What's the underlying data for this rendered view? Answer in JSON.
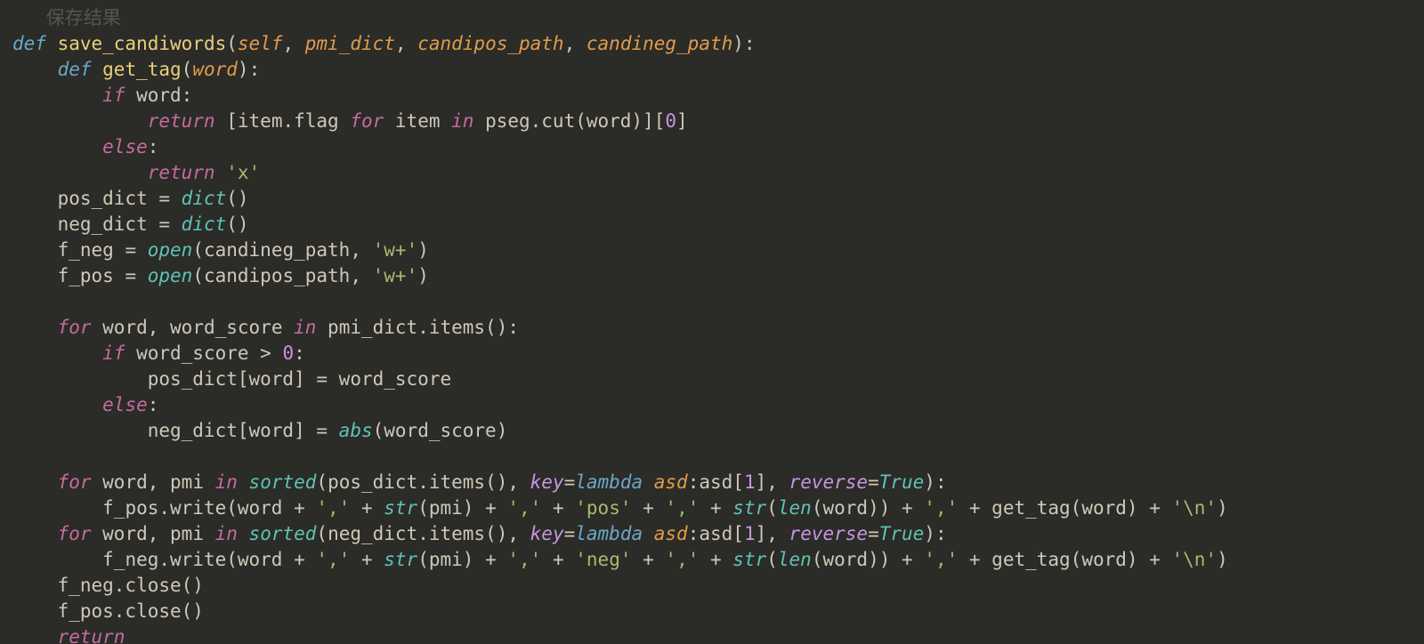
{
  "sig": {
    "def": "def ",
    "name1": "save_candiwords",
    "lp": "(",
    "self": "self",
    "c": ", ",
    "p1": "pmi_dict",
    "p2": "candipos_path",
    "p3": "candineg_path",
    "rp": ")",
    ":": ":"
  },
  "gt": {
    "def": "def ",
    "name": "get_tag",
    "lp": "(",
    "word": "word",
    "rp": ")",
    ":": ":",
    "if": "if ",
    "wref": "word",
    ":2": ":",
    "ret": "return ",
    "lb": "[",
    "item_flag": "item.flag ",
    "for": "for ",
    "item": "item ",
    "in": "in ",
    "pseg": "pseg.cut(word)",
    "rb": "][",
    "zero": "0",
    "rb2": "]",
    "else": "else",
    ":3": ":",
    "ret2": "return ",
    "xs": "'x'"
  },
  "assign": {
    "pos": "pos_dict ",
    "eq": "= ",
    "dict": "dict",
    "pp": "()",
    "neg": "neg_dict ",
    "fneg": "f_neg ",
    "open": "open",
    "lp": "(",
    "cneg": "candineg_path",
    "cm": ", ",
    "wplus": "'w+'",
    "rp": ")",
    "fpos": "f_pos ",
    "cpos": "candipos_path"
  },
  "loop1": {
    "for": "for ",
    "w": "word",
    "cm": ", ",
    "ws": "word_score ",
    "in": "in ",
    "pmi": "pmi_dict.items()",
    ":": ":",
    "if": "if ",
    "ws2": "word_score ",
    "gt": "> ",
    "zero": "0",
    ":2": ":",
    "pd": "pos_dict[word] ",
    "eq": "= ",
    "ws3": "word_score",
    "else": "else",
    ":3": ":",
    "nd": "neg_dict[word] ",
    "abs": "abs",
    "lp": "(",
    "ws4": "word_score",
    "rp": ")"
  },
  "loop2": {
    "for": "for ",
    "w": "word",
    "cm": ", ",
    "pmi": "pmi ",
    "in": "in ",
    "sorted": "sorted",
    "lp": "(",
    "pd": "pos_dict.items()",
    "cm2": ", ",
    "key": "key",
    "eq": "=",
    "lambda": "lambda ",
    "asd": "asd",
    ":": ":",
    "asdx": "asd[",
    "one": "1",
    "rb": "]",
    "cm3": ", ",
    "rev": "reverse",
    "eq2": "=",
    "true": "True",
    "rp": ")",
    ":2": ":",
    "fpos": "f_pos.write(",
    "wr": "word ",
    "plus": "+ ",
    "comma": "',' ",
    "str": "str",
    "lp2": "(",
    "pmiv": "pmi",
    "rp2": ") ",
    "pos": "'pos' ",
    "len": "len",
    "lp3": "(",
    "wr2": "word",
    "rp3": ")) ",
    "gettag": "get_tag(word) ",
    "nl": "'\\n'",
    "rp4": ")"
  },
  "loop3": {
    "for": "for ",
    "w": "word",
    "cm": ", ",
    "pmi": "pmi ",
    "in": "in ",
    "sorted": "sorted",
    "lp": "(",
    "nd": "neg_dict.items()",
    "cm2": ", ",
    "key": "key",
    "eq": "=",
    "lambda": "lambda ",
    "asd": "asd",
    ":": ":",
    "asdx": "asd[",
    "one": "1",
    "rb": "]",
    "cm3": ", ",
    "rev": "reverse",
    "eq2": "=",
    "true": "True",
    "rp": ")",
    ":2": ":",
    "fneg": "f_neg.write(",
    "wr": "word ",
    "plus": "+ ",
    "comma": "',' ",
    "str": "str",
    "lp2": "(",
    "pmiv": "pmi",
    "rp2": ") ",
    "neg": "'neg' ",
    "len": "len",
    "lp3": "(",
    "wr2": "word",
    "rp3": ")) ",
    "gettag": "get_tag(word) ",
    "nl": "'\\n'",
    "rp4": ")"
  },
  "close": {
    "fn": "f_neg.close()",
    "fp": "f_pos.close()",
    "ret": "return"
  },
  "faded": "   保存结果"
}
